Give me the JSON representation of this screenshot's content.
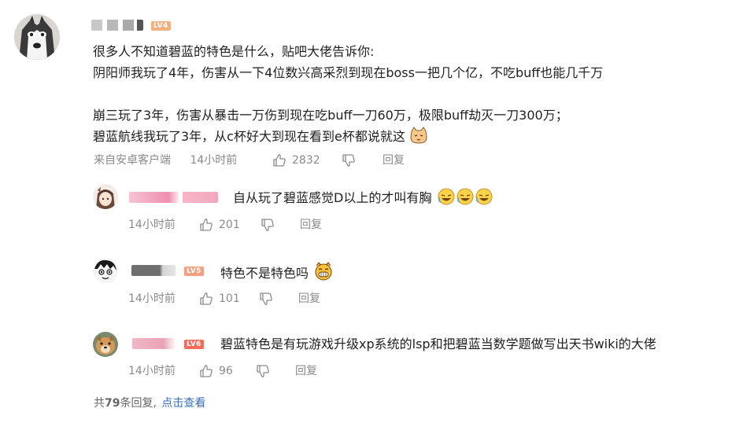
{
  "main_comment": {
    "level_badge": "LV4",
    "lines": [
      "很多人不知道碧蓝的特色是什么，贴吧大佬告诉你:",
      "阴阳师我玩了4年，伤害从一下4位数兴高采烈到现在boss一把几个亿，不吃buff也能几千万",
      "",
      "崩三玩了3年，伤害从暴击一万伤到现在吃buff一刀60万，极限buff劫灭一刀300万；",
      "碧蓝航线我玩了3年，从c杯好大到现在看到e杯都说就这"
    ],
    "source": "来自安卓客户端",
    "time": "14小时前",
    "likes": "2832",
    "reply_label": "回复"
  },
  "replies": [
    {
      "text": "自从玩了碧蓝感觉D以上的才叫有胸",
      "time": "14小时前",
      "likes": "201",
      "reply_label": "回复"
    },
    {
      "level_badge": "LV5",
      "text": "特色不是特色吗",
      "time": "14小时前",
      "likes": "101",
      "reply_label": "回复"
    },
    {
      "level_badge": "LV6",
      "text": "碧蓝特色是有玩游戏升级xp系统的lsp和把碧蓝当数学题做写出天书wiki的大佬",
      "time": "14小时前",
      "likes": "96",
      "reply_label": "回复"
    }
  ],
  "footer": {
    "prefix": "共",
    "count": "79",
    "suffix": "条回复,",
    "link": "点击查看"
  },
  "colors": {
    "link": "#3d6fb6",
    "meta": "#8a8a8a",
    "lv4": "#f2b07f",
    "lv5": "#f2a07f",
    "lv6": "#f26b5b"
  }
}
